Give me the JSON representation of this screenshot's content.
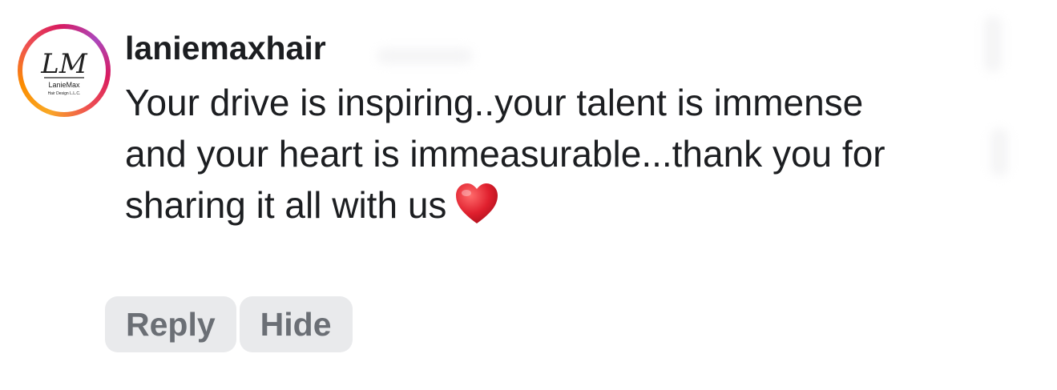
{
  "comment": {
    "username": "laniemaxhair",
    "text": "Your drive is inspiring..your talent is immense and your heart is immeasurable...thank you for sharing it all with us",
    "emoji_icon": "red-heart-icon"
  },
  "avatar": {
    "monogram": "LM",
    "brand": "LanieMax",
    "tagline": "Hair Design L.L.C."
  },
  "actions": {
    "reply_label": "Reply",
    "hide_label": "Hide"
  },
  "colors": {
    "text": "#1c1e21",
    "button_bg": "#e9eaec",
    "button_text": "#6b6f75",
    "heart": "#e0202e"
  }
}
